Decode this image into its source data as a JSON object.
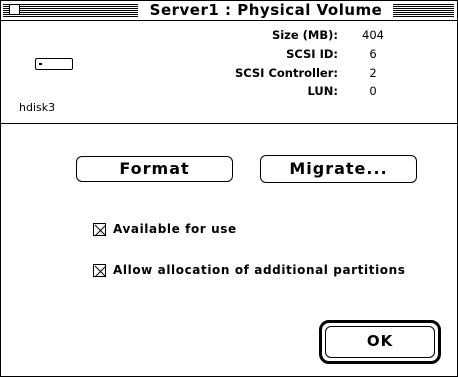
{
  "window": {
    "title": "Server1 : Physical Volume"
  },
  "disk": {
    "icon": "hard-disk-icon",
    "name": "hdisk3"
  },
  "properties": [
    {
      "label": "Size (MB):",
      "value": "404"
    },
    {
      "label": "SCSI ID:",
      "value": "6"
    },
    {
      "label": "SCSI Controller:",
      "value": "2"
    },
    {
      "label": "LUN:",
      "value": "0"
    }
  ],
  "buttons": {
    "format": "Format",
    "migrate": "Migrate...",
    "ok": "OK"
  },
  "options": [
    {
      "label": "Available for use",
      "checked": true
    },
    {
      "label": "Allow allocation of additional partitions",
      "checked": true
    }
  ]
}
